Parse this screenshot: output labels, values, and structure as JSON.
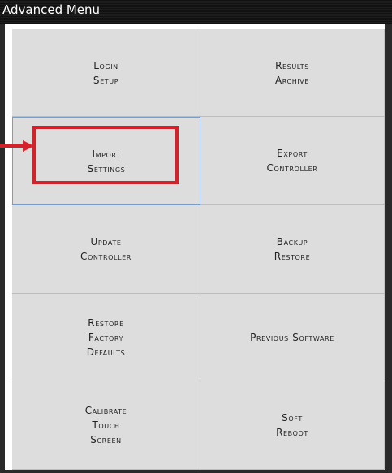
{
  "window": {
    "title": "Advanced Menu"
  },
  "menu": {
    "items": [
      {
        "id": "login-setup",
        "lines": [
          "Login",
          "Setup"
        ]
      },
      {
        "id": "results-archive",
        "lines": [
          "Results",
          "Archive"
        ]
      },
      {
        "id": "import-settings",
        "lines": [
          "Import",
          "Settings"
        ],
        "selected": true
      },
      {
        "id": "export-controller",
        "lines": [
          "Export",
          "Controller"
        ]
      },
      {
        "id": "update-controller",
        "lines": [
          "Update",
          "Controller"
        ]
      },
      {
        "id": "backup-restore",
        "lines": [
          "Backup",
          "Restore"
        ]
      },
      {
        "id": "restore-factory-defaults",
        "lines": [
          "Restore",
          "Factory",
          "Defaults"
        ]
      },
      {
        "id": "previous-software",
        "lines": [
          "Previous Software"
        ]
      },
      {
        "id": "calibrate-touch-screen",
        "lines": [
          "Calibrate",
          "Touch",
          "Screen"
        ]
      },
      {
        "id": "soft-reboot",
        "lines": [
          "Soft",
          "Reboot"
        ]
      }
    ]
  },
  "annotation": {
    "highlight_color": "#d3222a",
    "arrow_icon": "arrow-right-icon"
  }
}
